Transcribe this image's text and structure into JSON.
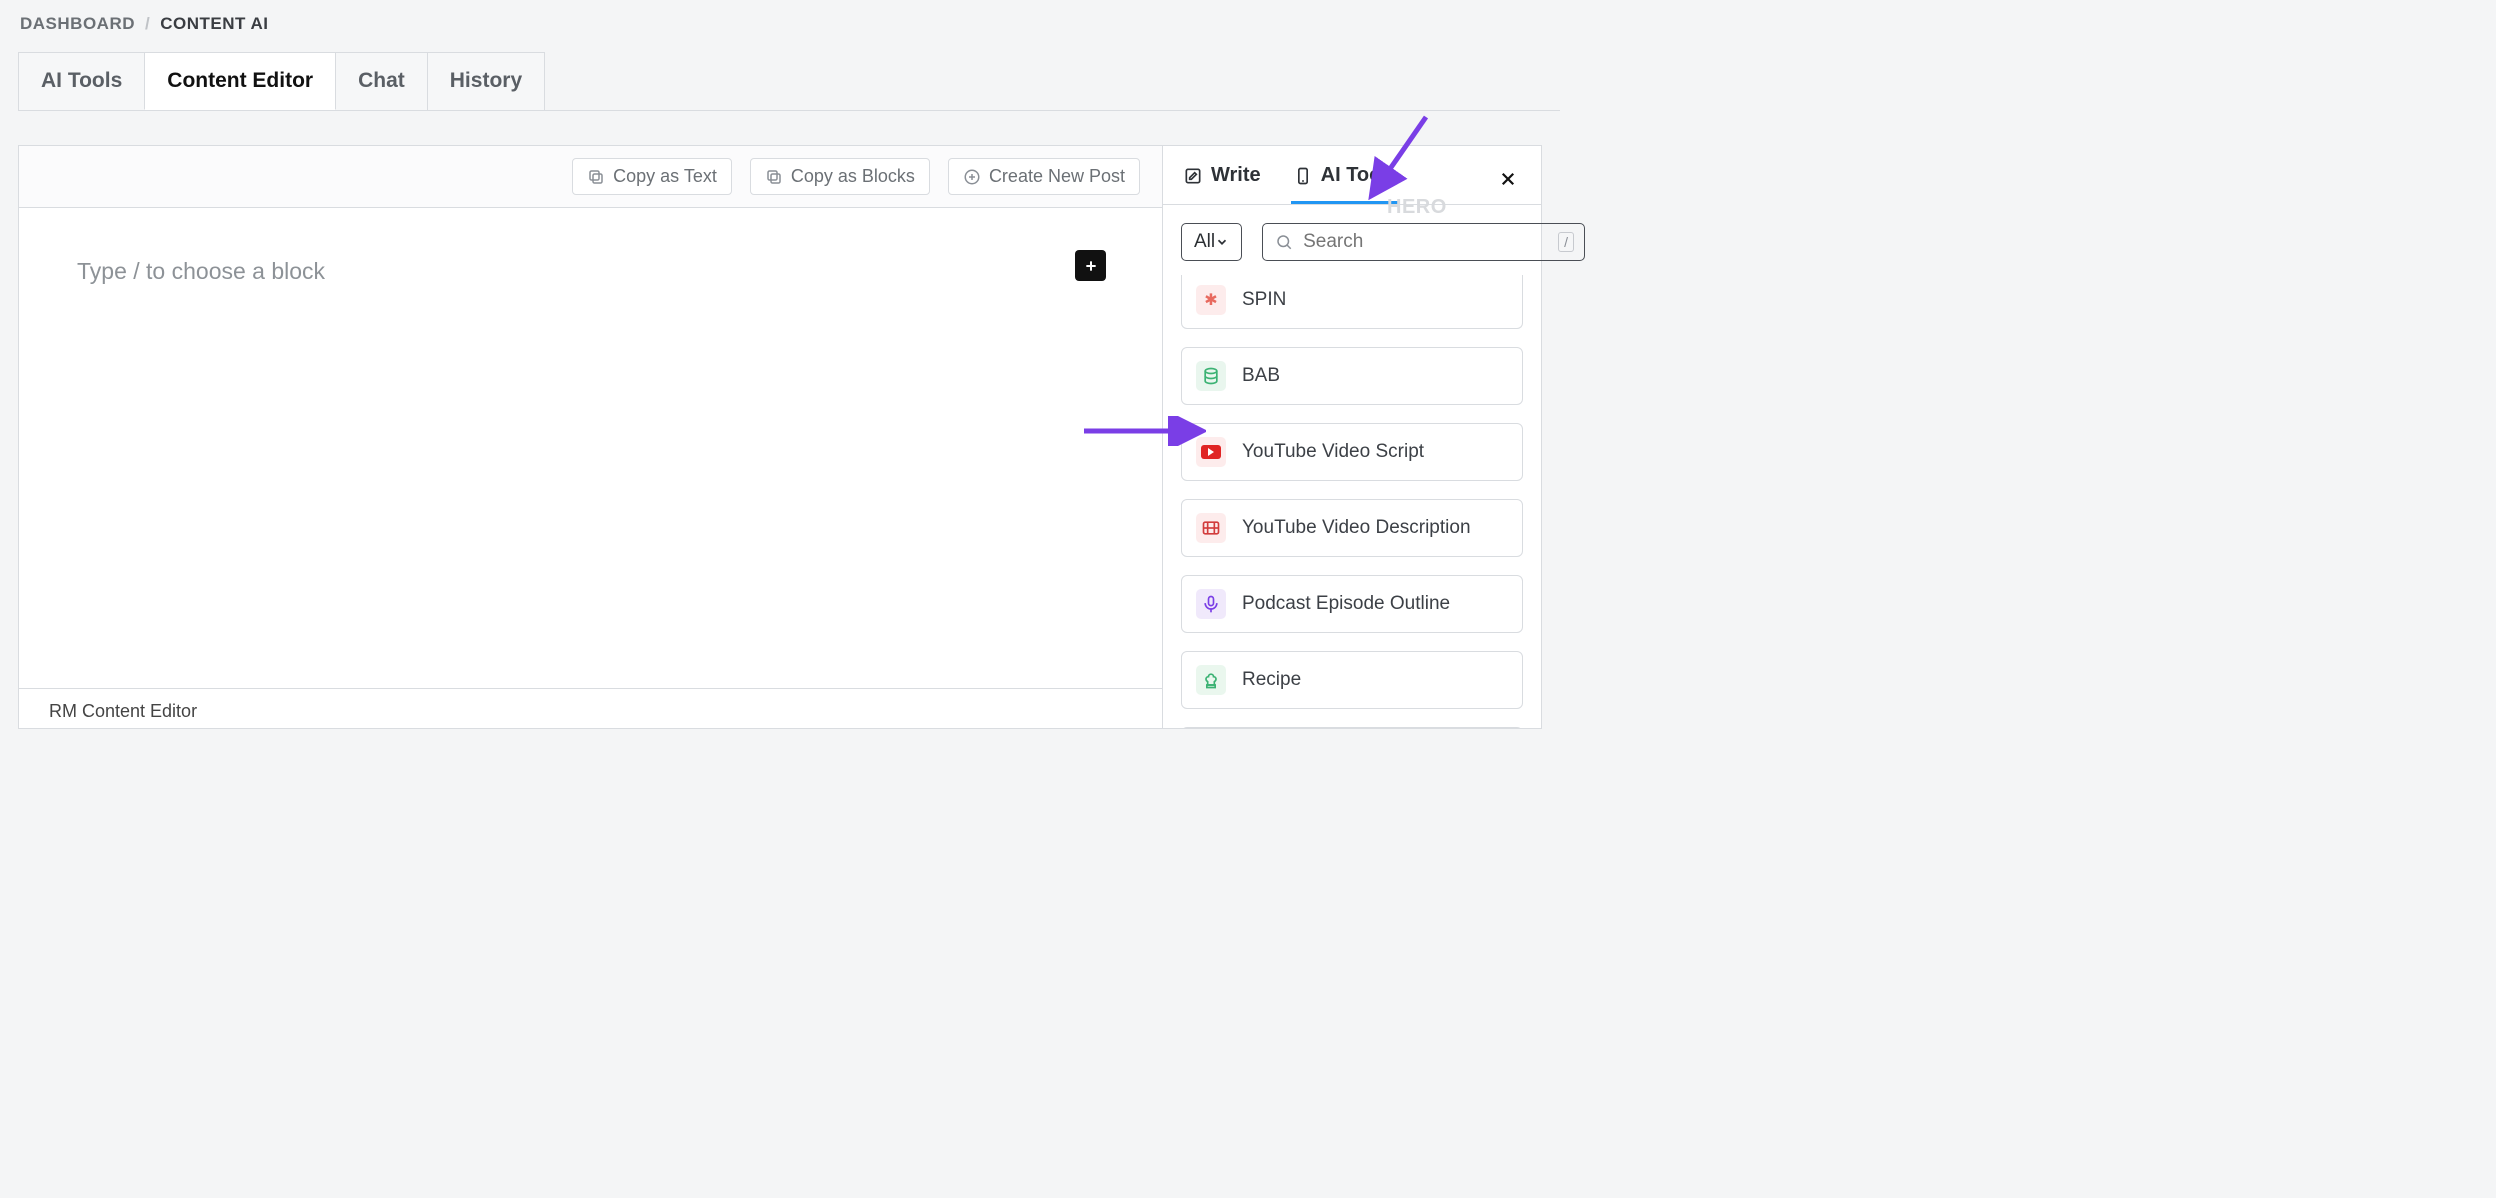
{
  "breadcrumb": {
    "root": "DASHBOARD",
    "sep": "/",
    "current": "CONTENT AI"
  },
  "tabs": [
    {
      "label": "AI Tools"
    },
    {
      "label": "Content Editor"
    },
    {
      "label": "Chat"
    },
    {
      "label": "History"
    }
  ],
  "active_tab_index": 1,
  "toolbar": {
    "copy_text": "Copy as Text",
    "copy_blocks": "Copy as Blocks",
    "create_post": "Create New Post"
  },
  "editor": {
    "placeholder": "Type / to choose a block"
  },
  "footer": "RM Content Editor",
  "sidebar": {
    "tabs": {
      "write": "Write",
      "ai_tools": "AI Tools"
    },
    "active_tab": "ai_tools",
    "filter": {
      "value": "All"
    },
    "search": {
      "placeholder": "Search",
      "kbd": "/"
    },
    "ghost": "HERO",
    "tools": [
      {
        "label": "SPIN",
        "icon": "spin"
      },
      {
        "label": "BAB",
        "icon": "bab"
      },
      {
        "label": "YouTube Video Script",
        "icon": "yt"
      },
      {
        "label": "YouTube Video Description",
        "icon": "ytd"
      },
      {
        "label": "Podcast Episode Outline",
        "icon": "pod"
      },
      {
        "label": "Recipe",
        "icon": "recipe"
      }
    ]
  }
}
